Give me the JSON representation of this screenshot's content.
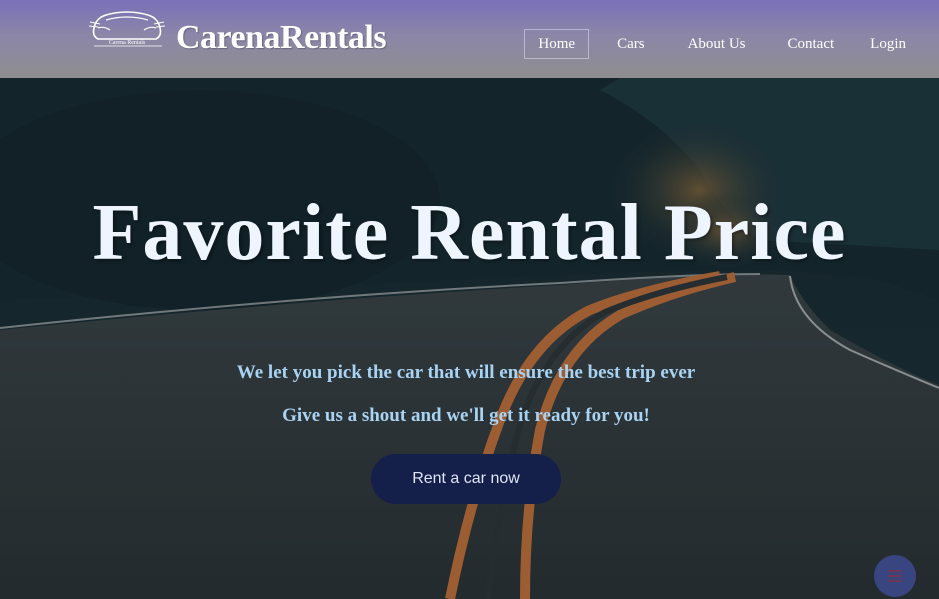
{
  "brand": {
    "logo_caption": "Carena Rentals",
    "name": "CarenaRentals"
  },
  "nav": {
    "items": [
      {
        "label": "Home",
        "active": true
      },
      {
        "label": "Cars",
        "active": false
      },
      {
        "label": "About Us",
        "active": false
      },
      {
        "label": "Contact",
        "active": false
      },
      {
        "label": "Login",
        "active": false
      }
    ]
  },
  "hero": {
    "title": "Favorite Rental Price",
    "subtitle_1": "We let you pick the car that will ensure the best trip ever",
    "subtitle_2": "Give us a shout and we'll get it ready for you!",
    "cta_label": "Rent a car now",
    "background_icon": "winding-road-image"
  },
  "floating_button": {
    "icon": "menu-icon"
  },
  "colors": {
    "header_top": "#7870b8",
    "header_bottom": "#8e8e8e",
    "title": "#eef5ff",
    "subtitle": "#a9d3f3",
    "cta_bg": "#141f4a",
    "cta_text": "#dfe6f5",
    "fab_bg": "#3c4a8e"
  }
}
